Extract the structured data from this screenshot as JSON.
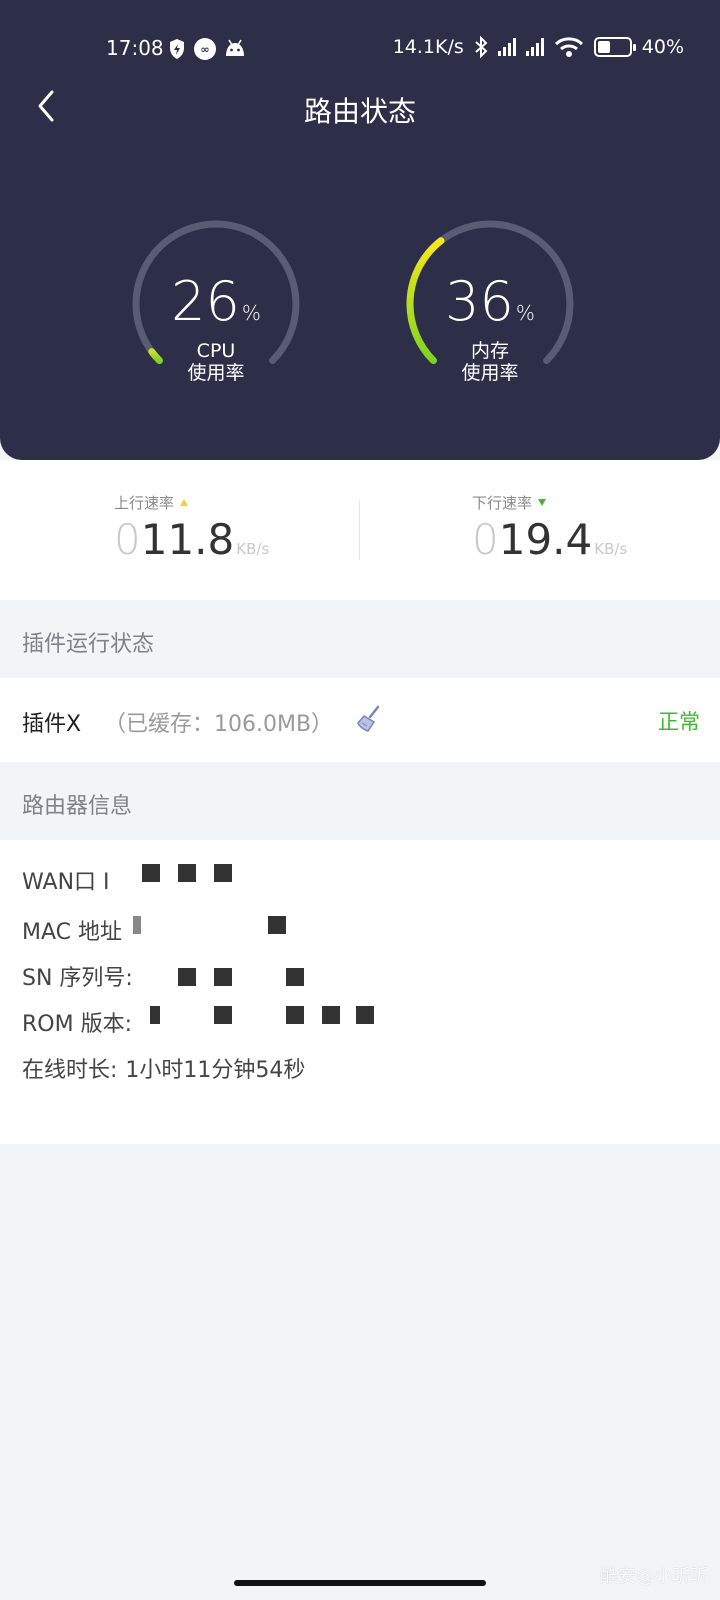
{
  "status_bar": {
    "time": "17:08",
    "net_speed": "14.1K/s",
    "battery": "40%",
    "battery_level": 0.4
  },
  "header": {
    "title": "路由状态"
  },
  "gauges": {
    "cpu": {
      "value": "26",
      "percent_sign": "%",
      "label_line1": "CPU",
      "label_line2": "使用率",
      "level": 0.26
    },
    "memory": {
      "value": "36",
      "percent_sign": "%",
      "label_line1": "内存",
      "label_line2": "使用率",
      "level": 0.36
    }
  },
  "colors": {
    "header_bg": "#2d2f48",
    "gauge_green": "#7ed321",
    "gauge_yellow": "#f8e71c",
    "status_green": "#3dbb2f"
  },
  "speed": {
    "upload": {
      "label": "上行速率",
      "leading": "0",
      "value": "11.8",
      "unit": "KB/s"
    },
    "download": {
      "label": "下行速率",
      "leading": "0",
      "value": "19.4",
      "unit": "KB/s"
    }
  },
  "plugins": {
    "section_title": "插件运行状态",
    "items": [
      {
        "name": "插件X",
        "cache": "（已缓存：106.0MB）",
        "status": "正常",
        "icon": "broom-icon"
      }
    ]
  },
  "router_info": {
    "section_title": "路由器信息",
    "wan_label": "WAN口 I",
    "mac_label": "MAC 地址",
    "sn_label": "SN 序列号:",
    "rom_label": "ROM 版本:",
    "uptime_label": "在线时长:",
    "uptime_value": "1小时11分钟54秒"
  },
  "watermark": "酷安@小昕昕"
}
